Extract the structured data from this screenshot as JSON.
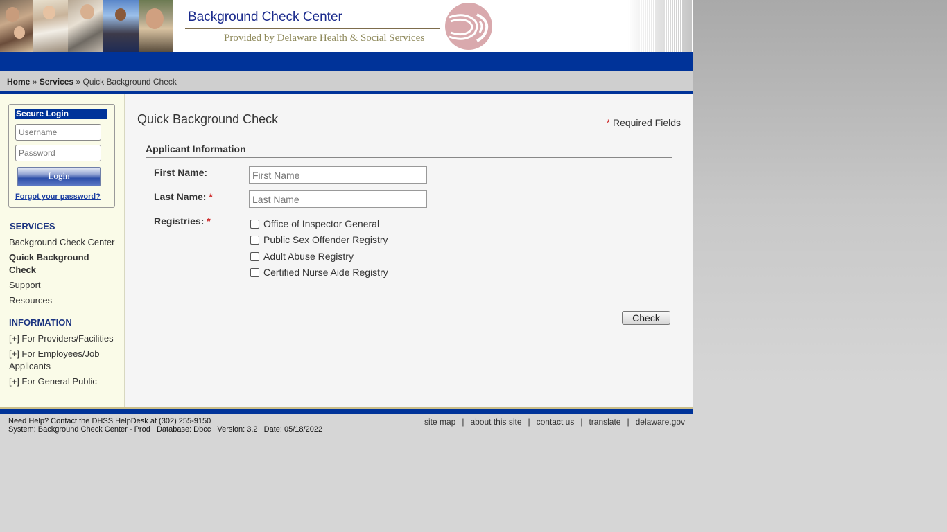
{
  "header": {
    "title": "Background Check Center",
    "subtitle": "Provided by Delaware Health & Social Services"
  },
  "breadcrumb": {
    "home": "Home",
    "sep1": "»",
    "services": "Services",
    "sep2": "»",
    "current": "Quick Background Check"
  },
  "login": {
    "heading": "Secure Login",
    "username_placeholder": "Username",
    "password_placeholder": "Password",
    "button_label": "Login",
    "forgot": "Forgot your password?"
  },
  "nav": {
    "services_heading": "SERVICES",
    "services": [
      "Background Check Center",
      "Quick Background Check",
      "Support",
      "Resources"
    ],
    "information_heading": "INFORMATION",
    "information": [
      "[+] For Providers/Facilities",
      "[+] For Employees/Job Applicants",
      "[+] For General Public"
    ]
  },
  "main": {
    "title": "Quick Background Check",
    "required_star": "*",
    "required_label": " Required Fields",
    "section_heading": "Applicant Information",
    "first_name_label": "First Name:",
    "first_name_placeholder": "First Name",
    "last_name_label": "Last Name:",
    "last_name_placeholder": "Last Name",
    "registries_label": "Registries:",
    "star": "*",
    "registries": [
      "Office of Inspector General",
      "Public Sex Offender Registry",
      "Adult Abuse Registry",
      "Certified Nurse Aide Registry"
    ],
    "check_button": "Check"
  },
  "footer": {
    "help": "Need Help? Contact the DHSS HelpDesk at (302) 255-9150",
    "system": "System: Background Check Center - Prod   Database: Dbcc   Version: 3.2   Date: 05/18/2022",
    "links": [
      "site map",
      "about this site",
      "contact us",
      "translate",
      "delaware.gov"
    ],
    "separator": "|"
  },
  "colors": {
    "brand_blue": "#003399",
    "sidebar_bg": "#fafbe8",
    "required_red": "#cc2222"
  }
}
